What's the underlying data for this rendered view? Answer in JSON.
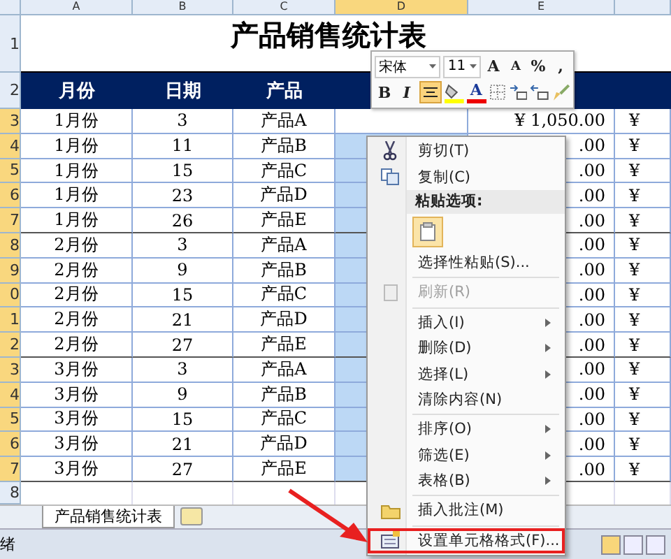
{
  "column_headers": [
    {
      "label": "A",
      "selected": false
    },
    {
      "label": "B",
      "selected": false
    },
    {
      "label": "C",
      "selected": false
    },
    {
      "label": "D",
      "selected": true
    },
    {
      "label": "E",
      "selected": false
    }
  ],
  "title_row": {
    "row_number": "1",
    "title": "产品销售统计表"
  },
  "header_row": {
    "row_number": "2",
    "cells": [
      "月份",
      "日期",
      "产品"
    ]
  },
  "rows": [
    {
      "row_number": "3",
      "month": "1月份",
      "day": "3",
      "product": "产品A",
      "column_e": "¥ 1,050.00",
      "column_f": "¥"
    },
    {
      "row_number": "4",
      "month": "1月份",
      "day": "11",
      "product": "产品B",
      "column_e": ".00",
      "column_f": "¥"
    },
    {
      "row_number": "5",
      "month": "1月份",
      "day": "15",
      "product": "产品C",
      "column_e": ".00",
      "column_f": "¥"
    },
    {
      "row_number": "6",
      "month": "1月份",
      "day": "23",
      "product": "产品D",
      "column_e": ".00",
      "column_f": "¥"
    },
    {
      "row_number": "7",
      "month": "1月份",
      "day": "26",
      "product": "产品E",
      "column_e": ".00",
      "column_f": "¥"
    },
    {
      "row_number": "8",
      "month": "2月份",
      "day": "3",
      "product": "产品A",
      "column_e": ".00",
      "column_f": "¥"
    },
    {
      "row_number": "9",
      "month": "2月份",
      "day": "9",
      "product": "产品B",
      "column_e": ".00",
      "column_f": "¥"
    },
    {
      "row_number": "0",
      "month": "2月份",
      "day": "15",
      "product": "产品C",
      "column_e": ".00",
      "column_f": "¥"
    },
    {
      "row_number": "1",
      "month": "2月份",
      "day": "21",
      "product": "产品D",
      "column_e": ".00",
      "column_f": "¥"
    },
    {
      "row_number": "2",
      "month": "2月份",
      "day": "27",
      "product": "产品E",
      "column_e": ".00",
      "column_f": "¥"
    },
    {
      "row_number": "3",
      "month": "3月份",
      "day": "3",
      "product": "产品A",
      "column_e": ".00",
      "column_f": "¥"
    },
    {
      "row_number": "4",
      "month": "3月份",
      "day": "9",
      "product": "产品B",
      "column_e": ".00",
      "column_f": "¥"
    },
    {
      "row_number": "5",
      "month": "3月份",
      "day": "15",
      "product": "产品C",
      "column_e": ".00",
      "column_f": "¥"
    },
    {
      "row_number": "6",
      "month": "3月份",
      "day": "21",
      "product": "产品D",
      "column_e": ".00",
      "column_f": "¥"
    },
    {
      "row_number": "7",
      "month": "3月份",
      "day": "27",
      "product": "产品E",
      "column_e": ".00",
      "column_f": "¥"
    }
  ],
  "empty_row_number": "8",
  "sheet_tabs": [
    {
      "label": "产品销售统计表",
      "selected": true
    }
  ],
  "status_bar": {
    "text": "绪"
  },
  "mini_toolbar": {
    "font": "宋体",
    "size": "11",
    "grow_font": "A",
    "shrink_font": "A",
    "percent": "%",
    "comma": ",",
    "bold": "B",
    "italic": "I",
    "font_color": "A",
    "center_align_on": true
  },
  "context_menu": [
    {
      "kind": "cut",
      "label": "剪切(T)",
      "disabled": false,
      "highlighted": false
    },
    {
      "kind": "copy",
      "label": "复制(C)",
      "disabled": false,
      "highlighted": false
    },
    {
      "kind": "heading",
      "label": "粘贴选项:"
    },
    {
      "kind": "paste-options"
    },
    {
      "kind": "plain",
      "label": "选择性粘贴(S)...",
      "disabled": false,
      "highlighted": false
    },
    {
      "kind": "separator"
    },
    {
      "kind": "refresh",
      "label": "刷新(R)",
      "disabled": true,
      "highlighted": false
    },
    {
      "kind": "separator"
    },
    {
      "kind": "submenu",
      "label": "插入(I)",
      "disabled": false,
      "highlighted": false
    },
    {
      "kind": "submenu",
      "label": "删除(D)",
      "disabled": false,
      "highlighted": false
    },
    {
      "kind": "submenu",
      "label": "选择(L)",
      "disabled": false,
      "highlighted": false
    },
    {
      "kind": "plain",
      "label": "清除内容(N)",
      "disabled": false,
      "highlighted": false
    },
    {
      "kind": "separator"
    },
    {
      "kind": "submenu",
      "label": "排序(O)",
      "disabled": false,
      "highlighted": false
    },
    {
      "kind": "submenu",
      "label": "筛选(E)",
      "disabled": false,
      "highlighted": false
    },
    {
      "kind": "submenu",
      "label": "表格(B)",
      "disabled": false,
      "highlighted": false
    },
    {
      "kind": "separator"
    },
    {
      "kind": "note",
      "label": "插入批注(M)",
      "disabled": false,
      "highlighted": false
    },
    {
      "kind": "separator"
    },
    {
      "kind": "format",
      "label": "设置单元格格式(F)...",
      "disabled": false,
      "highlighted": true
    }
  ]
}
